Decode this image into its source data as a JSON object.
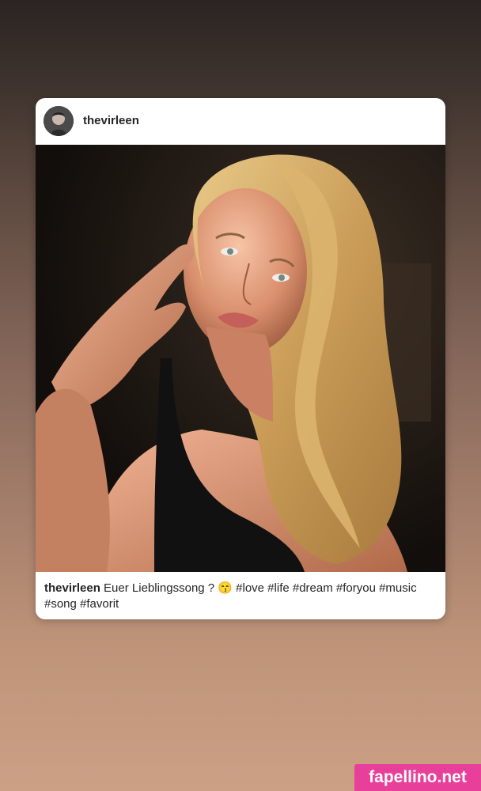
{
  "post": {
    "username": "thevirleen",
    "caption": {
      "username": "thevirleen",
      "text": "Euer Lieblingssong ? 😙 #love #life #dream #foryou #music #song #favorit"
    }
  },
  "watermark": {
    "text": "fapellino.net"
  },
  "colors": {
    "watermark_bg": "#e8409a",
    "card_bg": "#ffffff",
    "text": "#262626"
  }
}
